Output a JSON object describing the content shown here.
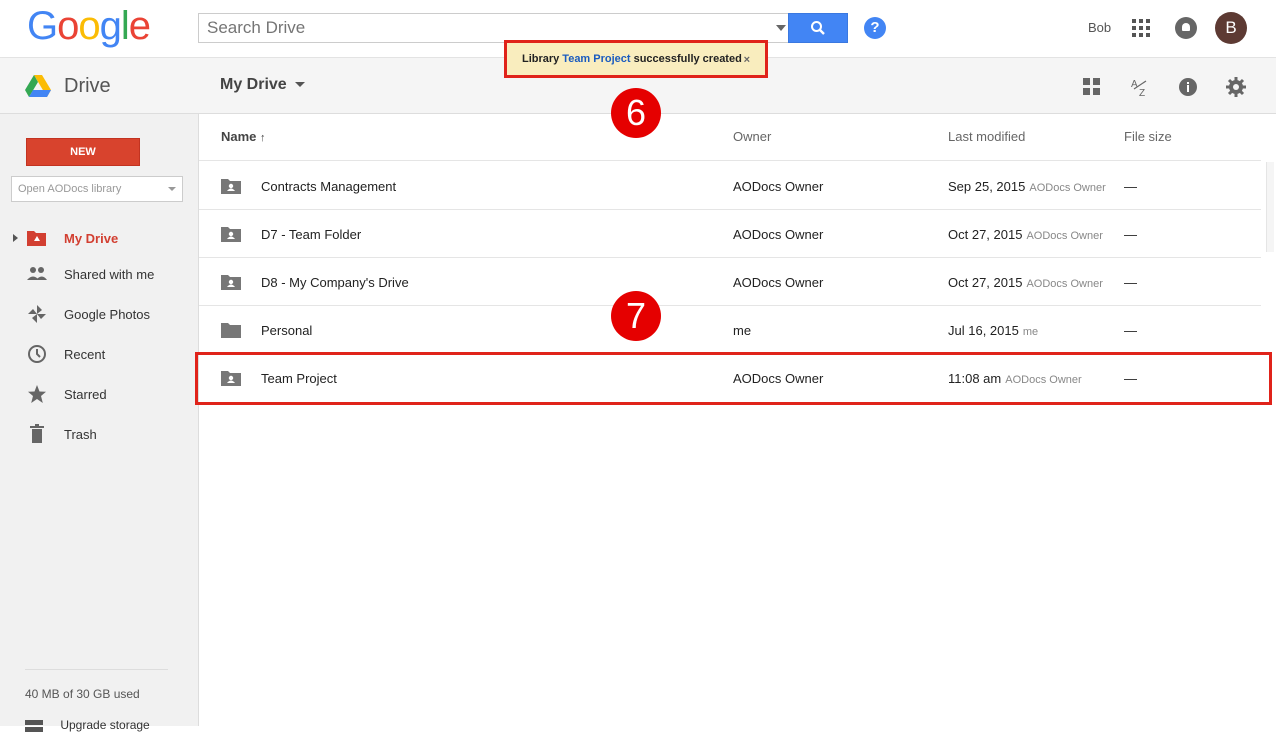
{
  "topbar": {
    "logo": [
      "G",
      "o",
      "o",
      "g",
      "l",
      "e"
    ],
    "logo_colors": [
      "#4285f4",
      "#ea4335",
      "#fbbc05",
      "#4285f4",
      "#34a853",
      "#ea4335"
    ],
    "search_placeholder": "Search Drive",
    "user_name": "Bob",
    "avatar_letter": "B"
  },
  "toast": {
    "prefix": "Library",
    "library_name": "Team Project",
    "suffix": "successfully created",
    "close": "×"
  },
  "subbar": {
    "app_name": "Drive",
    "location": "My Drive"
  },
  "sidebar": {
    "new_label": "NEW",
    "aodocs_placeholder": "Open AODocs library",
    "items": [
      {
        "label": "My Drive",
        "icon": "my-drive-icon",
        "active": true
      },
      {
        "label": "Shared with me",
        "icon": "shared-people-icon"
      },
      {
        "label": "Google Photos",
        "icon": "photos-pinwheel-icon"
      },
      {
        "label": "Recent",
        "icon": "clock-icon"
      },
      {
        "label": "Starred",
        "icon": "star-icon"
      },
      {
        "label": "Trash",
        "icon": "trash-icon"
      }
    ],
    "storage": "40 MB of 30 GB used",
    "upgrade": "Upgrade storage"
  },
  "list": {
    "headers": {
      "name": "Name",
      "sort_arrow": "↑",
      "owner": "Owner",
      "modified": "Last modified",
      "size": "File size"
    },
    "rows": [
      {
        "name": "Contracts Management",
        "owner": "AODocs Owner",
        "modified": "Sep 25, 2015",
        "modified_by": "AODocs Owner",
        "size": "—",
        "shared": true
      },
      {
        "name": "D7 - Team Folder",
        "owner": "AODocs Owner",
        "modified": "Oct 27, 2015",
        "modified_by": "AODocs Owner",
        "size": "—",
        "shared": true
      },
      {
        "name": "D8 - My Company's Drive",
        "owner": "AODocs Owner",
        "modified": "Oct 27, 2015",
        "modified_by": "AODocs Owner",
        "size": "—",
        "shared": true
      },
      {
        "name": "Personal",
        "owner": "me",
        "modified": "Jul 16, 2015",
        "modified_by": "me",
        "size": "—",
        "shared": false
      },
      {
        "name": "Team Project",
        "owner": "AODocs Owner",
        "modified": "11:08 am",
        "modified_by": "AODocs Owner",
        "size": "—",
        "shared": true
      }
    ]
  },
  "annotations": {
    "step_6": "6",
    "step_7": "7",
    "color": "#e50000"
  }
}
